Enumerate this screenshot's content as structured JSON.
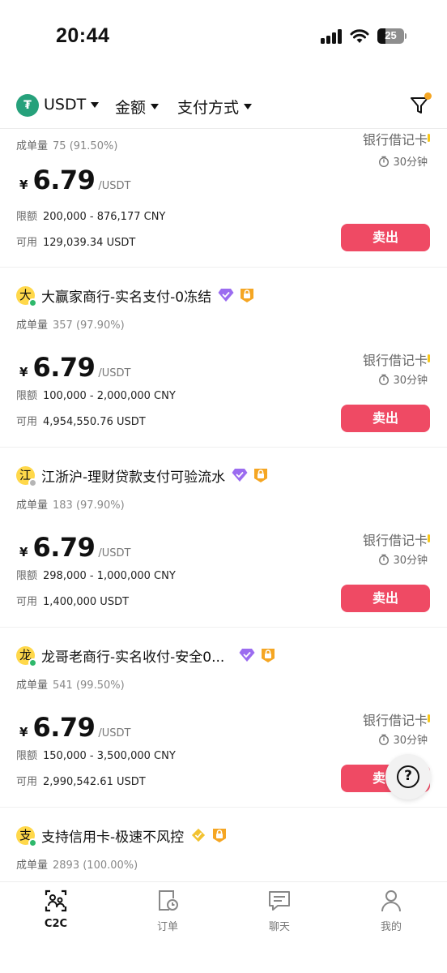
{
  "status_bar": {
    "time": "20:44",
    "battery": "25"
  },
  "filters": {
    "coin_symbol": "₮",
    "coin": "USDT",
    "amount": "金额",
    "payment": "支付方式"
  },
  "labels": {
    "deals": "成单量",
    "limit": "限额",
    "available": "可用",
    "currency_sign": "¥",
    "price_unit": "/USDT"
  },
  "top_partial": {
    "deals_value": "75 (91.50%)"
  },
  "listings": [
    {
      "merchant": "",
      "avatar": "",
      "deals_value": "",
      "price": "6.79",
      "limit": "200,000 - 876,177 CNY",
      "available": "129,039.34 USDT",
      "payment_method": "银行借记卡",
      "time_limit": "30分钟",
      "action": "卖出"
    },
    {
      "merchant": "大赢家商行-实名支付-0冻结",
      "avatar": "大",
      "deals_value": "357 (97.90%)",
      "price": "6.79",
      "limit": "100,000 - 2,000,000 CNY",
      "available": "4,954,550.76 USDT",
      "payment_method": "银行借记卡",
      "time_limit": "30分钟",
      "action": "卖出"
    },
    {
      "merchant": "江浙沪-理财贷款支付可验流水",
      "avatar": "江",
      "deals_value": "183 (97.90%)",
      "price": "6.79",
      "limit": "298,000 - 1,000,000 CNY",
      "available": "1,400,000 USDT",
      "payment_method": "银行借记卡",
      "time_limit": "30分钟",
      "action": "卖出"
    },
    {
      "merchant": "龙哥老商行-实名收付-安全0...",
      "avatar": "龙",
      "deals_value": "541 (99.50%)",
      "price": "6.79",
      "limit": "150,000 - 3,500,000 CNY",
      "available": "2,990,542.61 USDT",
      "payment_method": "银行借记卡",
      "time_limit": "30分钟",
      "action": "卖出"
    },
    {
      "merchant": "支持信用卡-极速不风控",
      "avatar": "支",
      "deals_value": "2893 (100.00%)"
    }
  ],
  "help": {
    "symbol": "?"
  },
  "bottom_nav": [
    {
      "label": "C2C",
      "icon": "c2c-icon",
      "active": true
    },
    {
      "label": "订单",
      "icon": "orders-icon",
      "active": false
    },
    {
      "label": "聊天",
      "icon": "chat-icon",
      "active": false
    },
    {
      "label": "我的",
      "icon": "profile-icon",
      "active": false
    }
  ],
  "colors": {
    "sell_button": "#ef4a64",
    "online": "#2eb86b",
    "avatar_bg": "#ffd84a",
    "gem": "#9b6cf0",
    "lock_badge": "#f5a623"
  }
}
